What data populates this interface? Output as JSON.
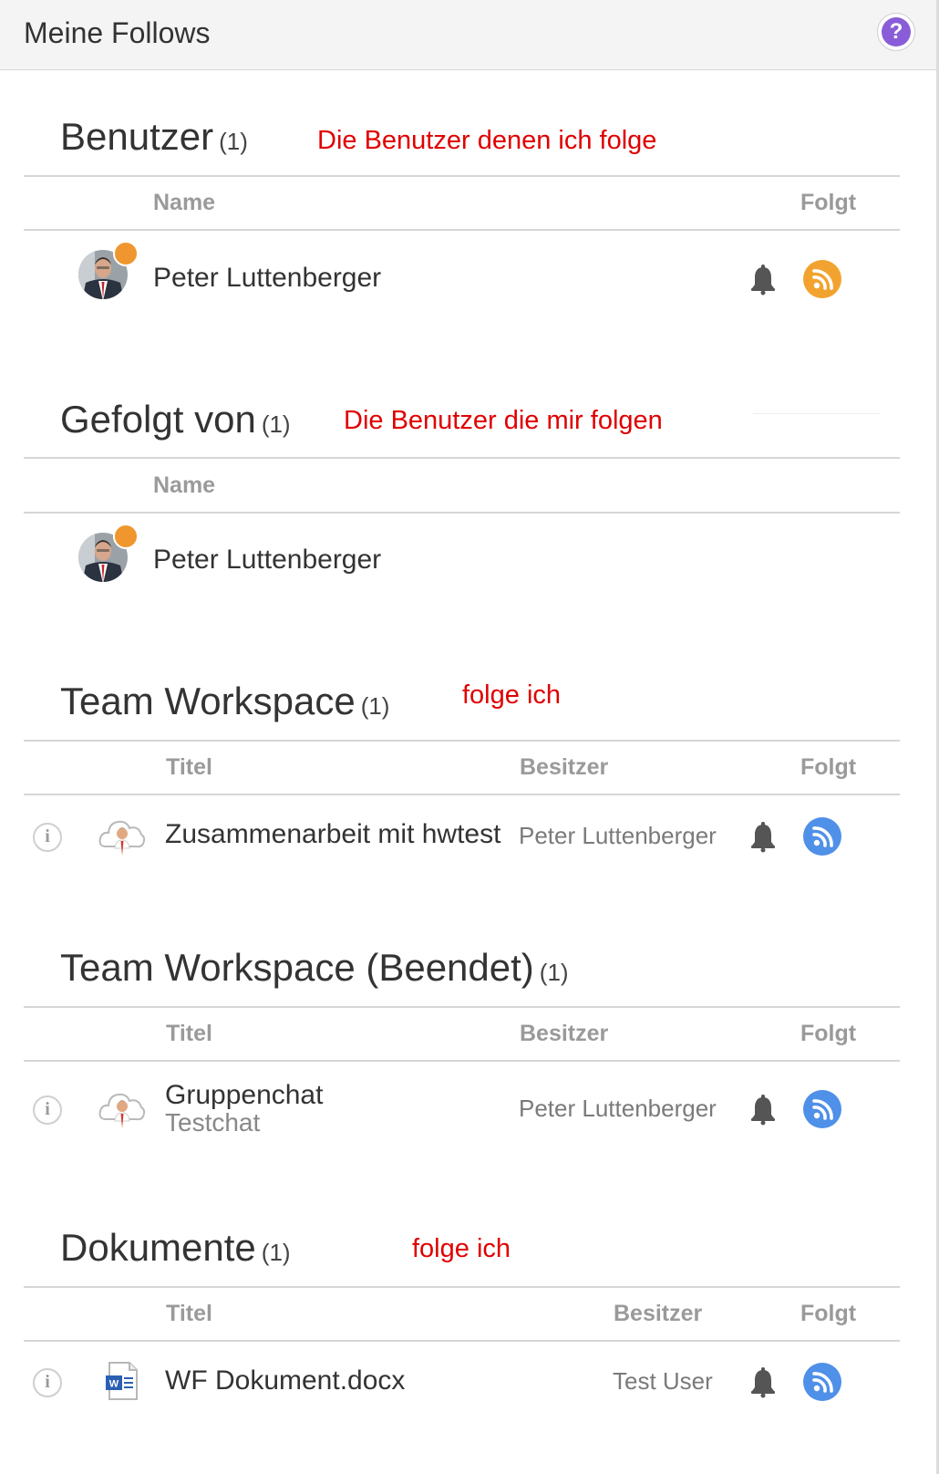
{
  "header": {
    "title": "Meine Follows",
    "help_icon": "?"
  },
  "sections": {
    "benutzer": {
      "title": "Benutzer",
      "count": "(1)",
      "annotation": "Die Benutzer denen ich folge",
      "columns": {
        "name": "Name",
        "folgt": "Folgt"
      },
      "rows": [
        {
          "name": "Peter Luttenberger",
          "status_color": "#f0962e",
          "follow_color": "#f2a32f"
        }
      ]
    },
    "gefolgt": {
      "title": "Gefolgt von",
      "count": "(1)",
      "annotation": "Die Benutzer die mir folgen",
      "columns": {
        "name": "Name"
      },
      "rows": [
        {
          "name": "Peter Luttenberger",
          "status_color": "#f0962e"
        }
      ]
    },
    "workspace": {
      "title": "Team Workspace",
      "count": "(1)",
      "annotation": "folge ich",
      "columns": {
        "titel": "Titel",
        "besitzer": "Besitzer",
        "folgt": "Folgt"
      },
      "rows": [
        {
          "title": "Zusammenarbeit mit hwtest",
          "owner": "Peter Luttenberger",
          "follow_color": "#4f90e8"
        }
      ]
    },
    "workspace_beendet": {
      "title": "Team Workspace (Beendet)",
      "count": "(1)",
      "columns": {
        "titel": "Titel",
        "besitzer": "Besitzer",
        "folgt": "Folgt"
      },
      "rows": [
        {
          "title": "Gruppenchat",
          "subtitle": "Testchat",
          "owner": "Peter Luttenberger",
          "follow_color": "#4f90e8"
        }
      ]
    },
    "dokumente": {
      "title": "Dokumente",
      "count": "(1)",
      "annotation": "folge ich",
      "columns": {
        "titel": "Titel",
        "besitzer": "Besitzer",
        "folgt": "Folgt"
      },
      "rows": [
        {
          "title": "WF Dokument.docx",
          "owner": "Test User",
          "follow_color": "#4f90e8"
        }
      ]
    }
  }
}
